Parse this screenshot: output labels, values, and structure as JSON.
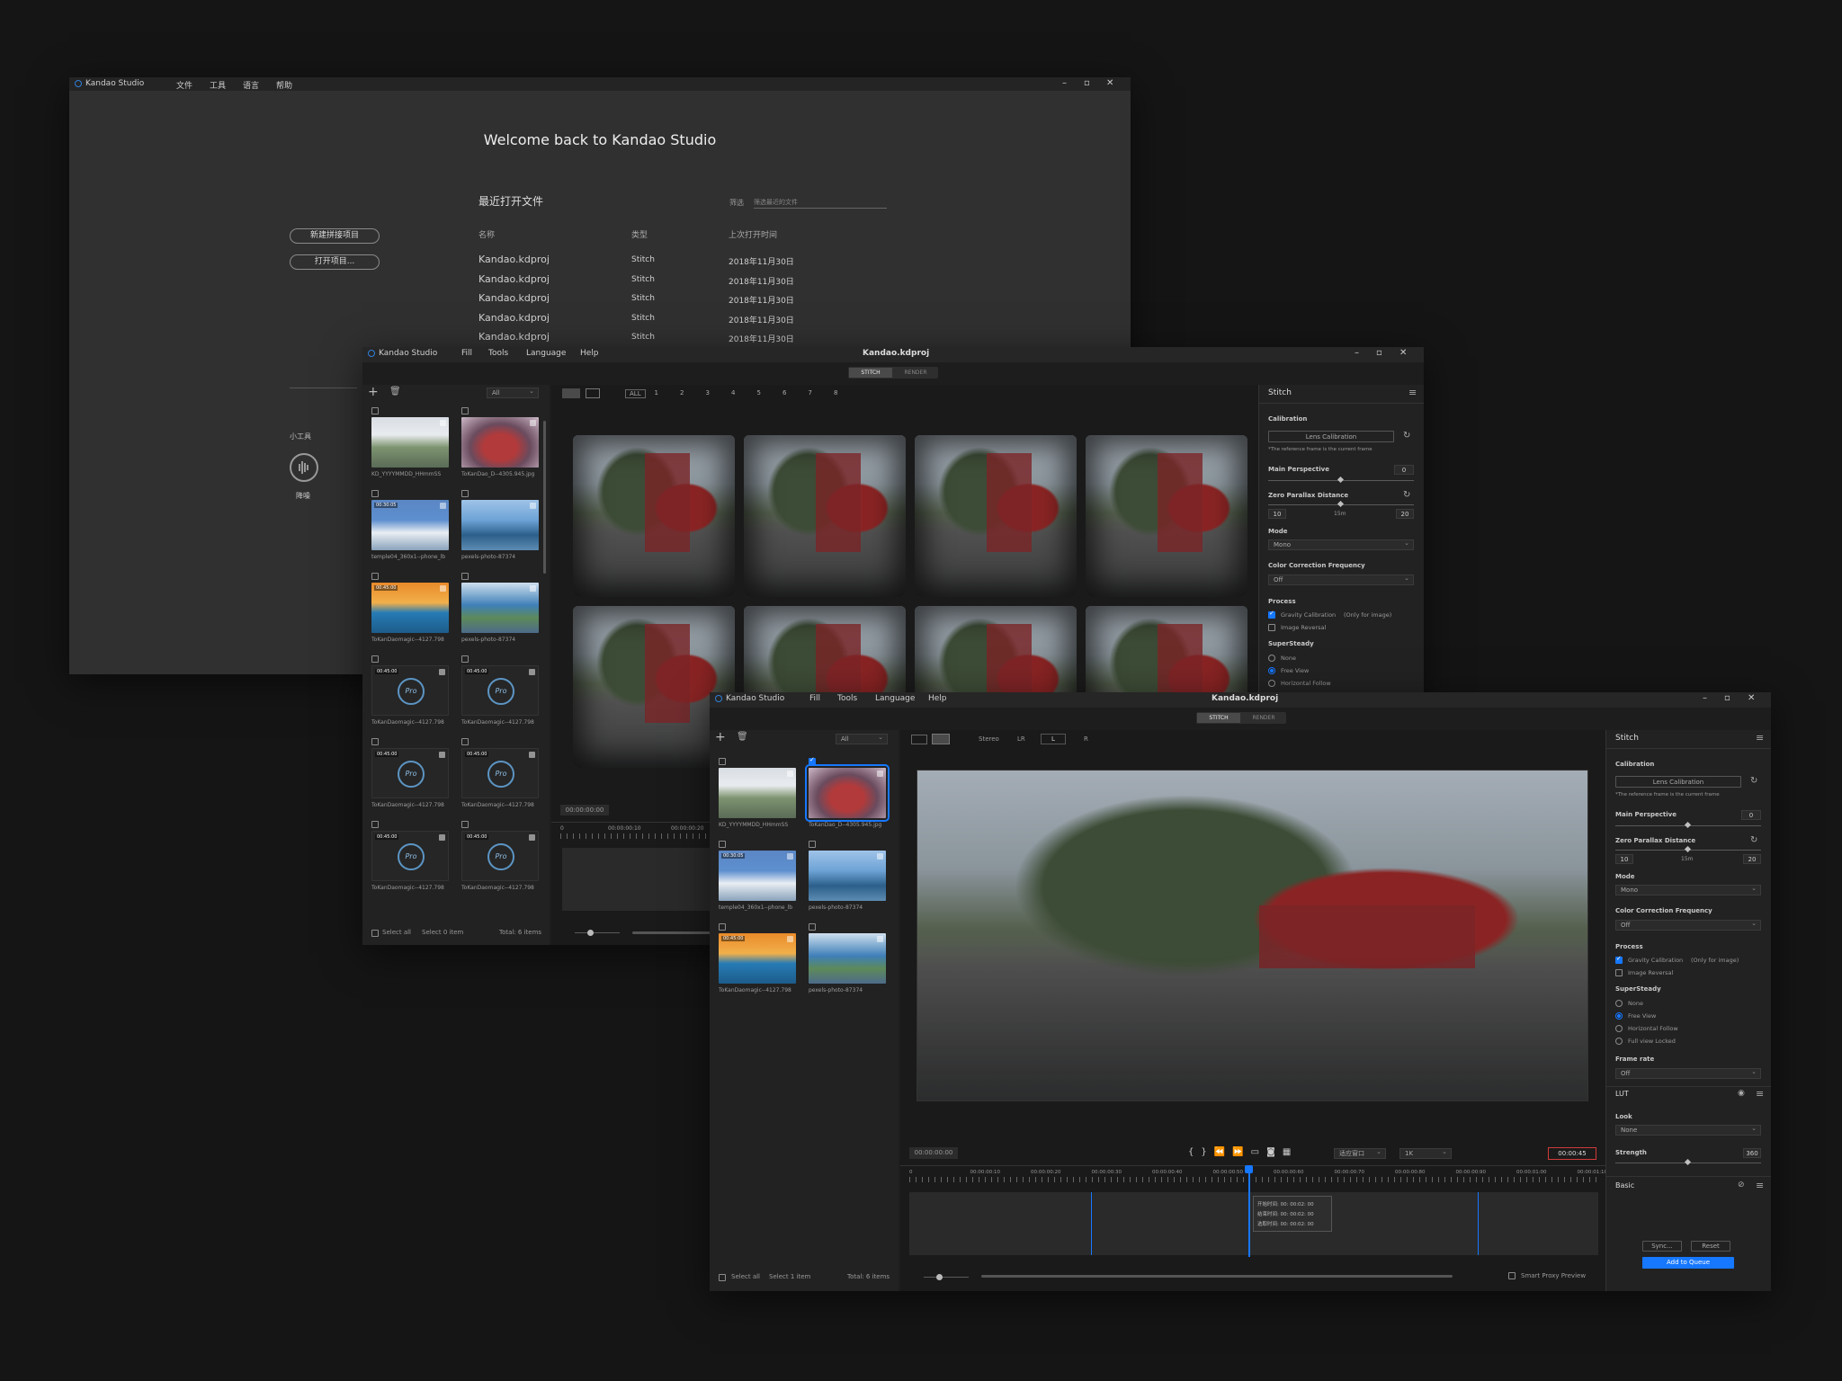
{
  "app_name": "Kandao Studio",
  "welcome": {
    "menus": [
      "文件",
      "工具",
      "语言",
      "帮助"
    ],
    "title": "Welcome back to Kandao Studio",
    "recent_heading": "最近打开文件",
    "filter_label": "筛选",
    "filter_placeholder": "筛选最近的文件",
    "btn_new": "新建拼接项目",
    "btn_open": "打开项目...",
    "columns": [
      "名称",
      "类型",
      "上次打开时间"
    ],
    "rows": [
      {
        "name": "Kandao.kdproj",
        "type": "Stitch",
        "time": "2018年11月30日"
      },
      {
        "name": "Kandao.kdproj",
        "type": "Stitch",
        "time": "2018年11月30日"
      },
      {
        "name": "Kandao.kdproj",
        "type": "Stitch",
        "time": "2018年11月30日"
      },
      {
        "name": "Kandao.kdproj",
        "type": "Stitch",
        "time": "2018年11月30日"
      },
      {
        "name": "Kandao.kdproj",
        "type": "Stitch",
        "time": "2018年11月30日"
      }
    ],
    "tools_heading": "小工具",
    "tool_label": "降噪"
  },
  "project_title": "Kandao.kdproj",
  "menus_en": [
    "Fill",
    "Tools",
    "Language",
    "Help"
  ],
  "tabs": [
    "STITCH",
    "RENDER"
  ],
  "filter_all": "All",
  "cams": [
    "ALL",
    "1",
    "2",
    "3",
    "4",
    "5",
    "6",
    "7",
    "8"
  ],
  "media_mid": [
    {
      "ts": "",
      "cap": "KD_YYYYMMDD_HHmmSS"
    },
    {
      "ts": "",
      "cap": "ToKanDao_D--4305.945.jpg"
    },
    {
      "ts": "00:30:05",
      "cap": "temple04_360x1--phone_lb"
    },
    {
      "ts": "",
      "cap": "pexels-photo-87374"
    },
    {
      "ts": "00:45:00",
      "cap": "ToKanDaomagic--4127.798"
    },
    {
      "ts": "",
      "cap": "pexels-photo-87374"
    },
    {
      "ts": "00:45:00",
      "cap": "ToKanDaomagic--4127.798"
    },
    {
      "ts": "00:45:00",
      "cap": "ToKanDaomagic--4127.798"
    },
    {
      "ts": "00:45:00",
      "cap": "ToKanDaomagic--4127.798"
    },
    {
      "ts": "00:45:00",
      "cap": "ToKanDaomagic--4127.798"
    },
    {
      "ts": "00:45:00",
      "cap": "ToKanDaomagic--4127.798"
    },
    {
      "ts": "00:45:00",
      "cap": "ToKanDaomagic--4127.798"
    }
  ],
  "media_front": [
    {
      "ts": "",
      "cap": "KD_YYYYMMDD_HHmmSS"
    },
    {
      "ts": "",
      "cap": "ToKanDao_D--4305.945.jpg"
    },
    {
      "ts": "00:30:05",
      "cap": "temple04_360x1--phone_lb"
    },
    {
      "ts": "",
      "cap": "pexels-photo-87374"
    },
    {
      "ts": "00:45:00",
      "cap": "ToKanDaomagic--4127.798"
    },
    {
      "ts": "",
      "cap": "pexels-photo-87374"
    }
  ],
  "pro_label": "Pro",
  "footer_mid": {
    "select_all": "Select all",
    "selected": "Select 0 item",
    "total": "Total: 6 items"
  },
  "footer_front": {
    "select_all": "Select all",
    "selected": "Select 1 item",
    "total": "Total: 6 items",
    "proxy": "Smart Proxy Preview"
  },
  "timecode_zero": "00:00:00:00",
  "ruler_mid": [
    "0",
    "00:00:00:10",
    "00:00:00:20"
  ],
  "ruler_front": [
    "0",
    "00:00:00:10",
    "00:00:00:20",
    "00:00:00:30",
    "00:00:00:40",
    "00:00:00:50",
    "00:00:00:60",
    "00:00:00:70",
    "00:00:00:80",
    "00:00:00:90",
    "00:00:01:00",
    "00:00:01:10"
  ],
  "viewer": {
    "stereo": "Stereo",
    "lr": "LR",
    "l": "L",
    "r": "R"
  },
  "playback": {
    "viewport": "适应窗口",
    "quality": "1K",
    "end_tc": "00:00:45"
  },
  "marker": {
    "start": "开始时间: 00: 00:02: 00",
    "end": "结束时间: 00: 00:02: 00",
    "dur": "选取时间: 00: 00:02: 00"
  },
  "stitch": {
    "title": "Stitch",
    "calibration": "Calibration",
    "lens_cal": "Lens Calibration",
    "note": "*The reference frame is the current frame",
    "main_persp": "Main Perspective",
    "main_persp_val": "0",
    "zpd": "Zero Parallax Distance",
    "zpd_min": "10",
    "zpd_mid": "15m",
    "zpd_max": "20",
    "mode": "Mode",
    "mode_val": "Mono",
    "ccf": "Color Correction Frequency",
    "ccf_val": "Off",
    "process": "Process",
    "gravity": "Gravity Calibration",
    "only_img": "(Only for image)",
    "reversal": "Image Reversal",
    "supersteady": "SuperSteady",
    "ss_opts": [
      "None",
      "Free View",
      "Horizontal Follow",
      "Full view Locked"
    ],
    "framerate": "Frame rate",
    "framerate_val": "Off"
  },
  "lut": {
    "title": "LUT",
    "look": "Look",
    "look_val": "None",
    "strength": "Strength",
    "strength_val": "360"
  },
  "basic": {
    "title": "Basic",
    "sync": "Sync...",
    "reset": "Reset",
    "queue": "Add to Queue"
  },
  "thumb_colors": {
    "tent": "#b33a3a",
    "sky": "#5d8fcf",
    "orange": "#e98a2a",
    "city": "#3f7fb8"
  }
}
